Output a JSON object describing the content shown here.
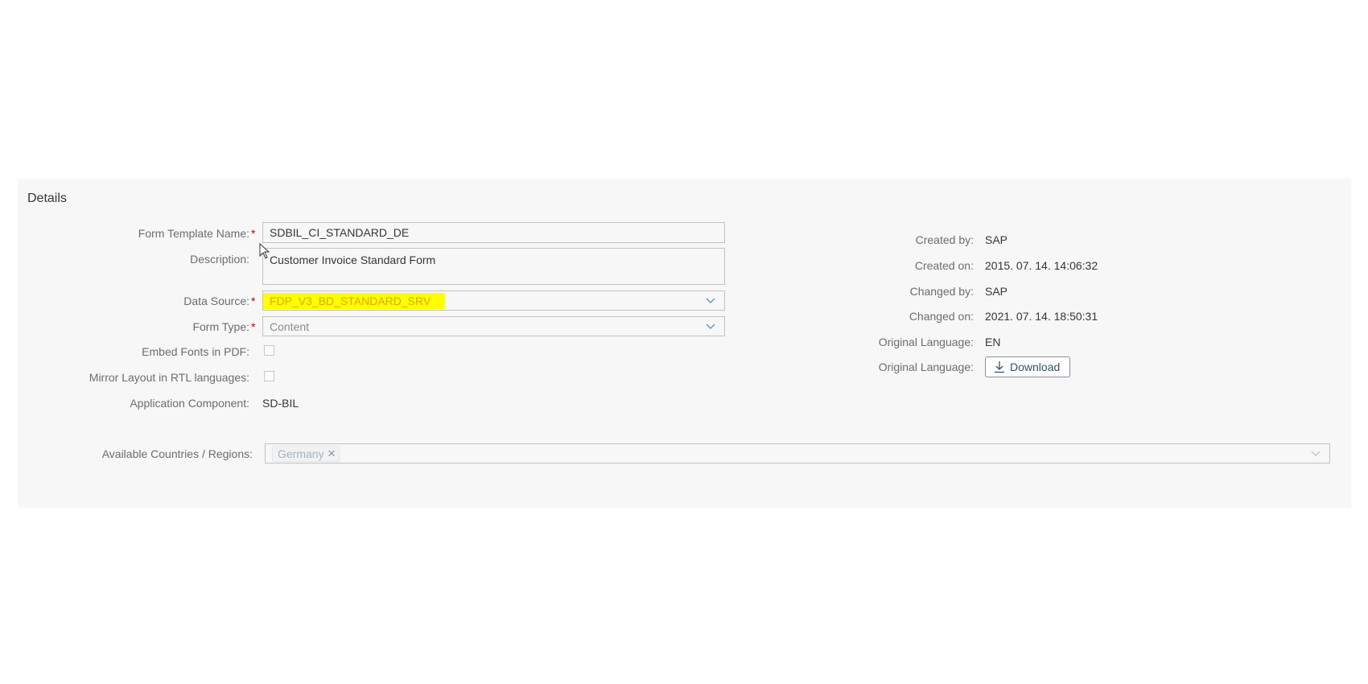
{
  "details": {
    "title": "Details",
    "form_template_name": {
      "label": "Form Template Name:",
      "required": "*",
      "value": "SDBIL_CI_STANDARD_DE"
    },
    "description": {
      "label": "Description:",
      "value": "Customer Invoice Standard Form"
    },
    "data_source": {
      "label": "Data Source:",
      "required": "*",
      "value": "FDP_V3_BD_STANDARD_SRV",
      "highlight_color": "#ffff00"
    },
    "form_type": {
      "label": "Form Type:",
      "required": "*",
      "value": "Content"
    },
    "embed_fonts": {
      "label": "Embed Fonts in PDF:",
      "checked": false
    },
    "mirror_layout": {
      "label": "Mirror Layout in RTL languages:",
      "checked": false
    },
    "application_component": {
      "label": "Application Component:",
      "value": "SD-BIL"
    },
    "available_countries": {
      "label": "Available Countries / Regions:",
      "tokens": [
        "Germany"
      ]
    }
  },
  "meta": {
    "created_by": {
      "label": "Created by:",
      "value": "SAP"
    },
    "created_on": {
      "label": "Created on:",
      "value": "2015. 07. 14. 14:06:32"
    },
    "changed_by": {
      "label": "Changed by:",
      "value": "SAP"
    },
    "changed_on": {
      "label": "Changed on:",
      "value": "2021. 07. 14. 18:50:31"
    },
    "original_language": {
      "label": "Original Language:",
      "value": "EN"
    },
    "original_language_file": {
      "label": "Original Language:",
      "button_label": "Download"
    }
  },
  "icons": {
    "dropdown": "chevron-down-icon",
    "download": "download-icon",
    "token_remove": "close-icon"
  },
  "colors": {
    "required": "#bb0000",
    "link": "#34506a",
    "panel_bg": "#f7f7f7"
  }
}
